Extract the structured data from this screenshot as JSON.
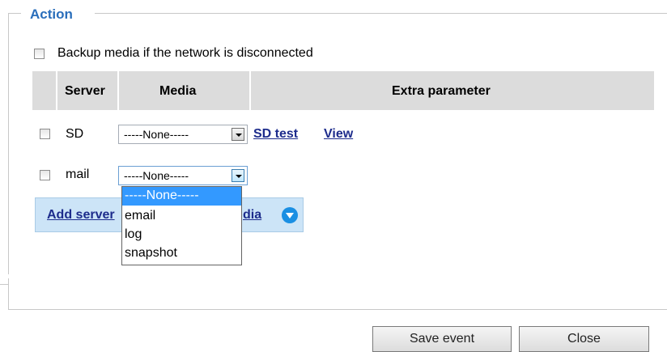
{
  "section": {
    "legend": "Action"
  },
  "backup": {
    "label": "Backup media if the network is disconnected",
    "checked": false
  },
  "table": {
    "headers": {
      "server": "Server",
      "media": "Media",
      "extra": "Extra parameter"
    },
    "rows": [
      {
        "server": "SD",
        "media": "-----None-----",
        "links": [
          "SD test",
          "View"
        ]
      },
      {
        "server": "mail",
        "media": "-----None-----"
      }
    ]
  },
  "add_link": {
    "label": "Add server",
    "suffix": "dia"
  },
  "dropdown": {
    "options": [
      "-----None-----",
      "email",
      "log",
      "snapshot"
    ],
    "selected_index": 0
  },
  "buttons": {
    "save": "Save event",
    "close": "Close"
  },
  "colors": {
    "legend": "#2a6ebb",
    "highlight": "#3399ff",
    "link": "#1d2c8c",
    "add_bar": "#cce4f7"
  }
}
